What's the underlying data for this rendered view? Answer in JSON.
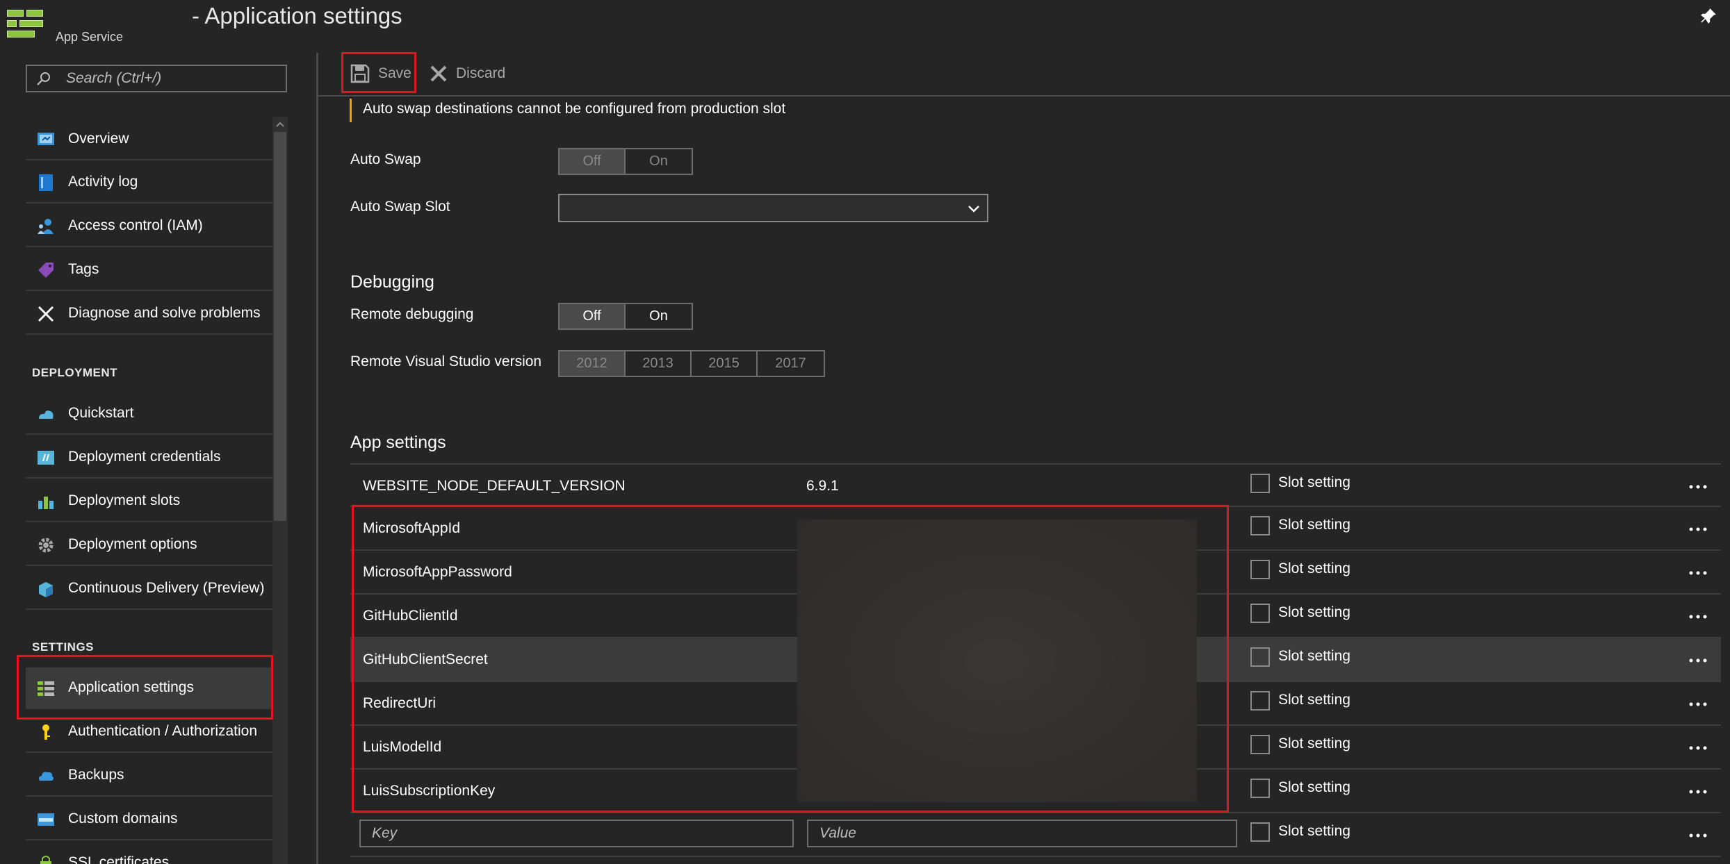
{
  "header": {
    "brand_sub": "App Service",
    "title": "- Application settings"
  },
  "sidebar": {
    "search_placeholder": "Search (Ctrl+/)",
    "items": [
      {
        "label": "Overview",
        "icon": "overview-icon"
      },
      {
        "label": "Activity log",
        "icon": "activity-log-icon"
      },
      {
        "label": "Access control (IAM)",
        "icon": "access-control-icon"
      },
      {
        "label": "Tags",
        "icon": "tag-icon"
      },
      {
        "label": "Diagnose and solve problems",
        "icon": "wrench-icon"
      }
    ],
    "deployment_header": "DEPLOYMENT",
    "deployment_items": [
      {
        "label": "Quickstart",
        "icon": "quickstart-icon"
      },
      {
        "label": "Deployment credentials",
        "icon": "credentials-icon"
      },
      {
        "label": "Deployment slots",
        "icon": "slots-icon"
      },
      {
        "label": "Deployment options",
        "icon": "gear-icon"
      },
      {
        "label": "Continuous Delivery (Preview)",
        "icon": "continuous-delivery-icon"
      }
    ],
    "settings_header": "SETTINGS",
    "settings_items": [
      {
        "label": "Application settings",
        "icon": "app-settings-icon"
      },
      {
        "label": "Authentication / Authorization",
        "icon": "key-icon"
      },
      {
        "label": "Backups",
        "icon": "cloud-icon"
      },
      {
        "label": "Custom domains",
        "icon": "www-icon"
      },
      {
        "label": "SSL certificates",
        "icon": "ssl-icon"
      }
    ]
  },
  "toolbar": {
    "save_label": "Save",
    "discard_label": "Discard"
  },
  "main": {
    "warning": "Auto swap destinations cannot be configured from production slot",
    "auto_swap": {
      "label": "Auto Swap",
      "options": [
        "Off",
        "On"
      ],
      "selected": "Off"
    },
    "auto_swap_slot": {
      "label": "Auto Swap Slot",
      "value": ""
    },
    "debugging": {
      "title": "Debugging",
      "remote_debugging": {
        "label": "Remote debugging",
        "options": [
          "Off",
          "On"
        ],
        "selected": "Off"
      },
      "vs_version": {
        "label": "Remote Visual Studio version",
        "options": [
          "2012",
          "2013",
          "2015",
          "2017"
        ],
        "selected": "2012"
      }
    },
    "app_settings": {
      "title": "App settings",
      "slot_label": "Slot setting",
      "rows": [
        {
          "key": "WEBSITE_NODE_DEFAULT_VERSION",
          "value": "6.9.1"
        },
        {
          "key": "MicrosoftAppId",
          "value": ""
        },
        {
          "key": "MicrosoftAppPassword",
          "value": ""
        },
        {
          "key": "GitHubClientId",
          "value": ""
        },
        {
          "key": "GitHubClientSecret",
          "value": ""
        },
        {
          "key": "RedirectUri",
          "value": ""
        },
        {
          "key": "LuisModelId",
          "value": ""
        },
        {
          "key": "LuisSubscriptionKey",
          "value": ""
        }
      ],
      "new_key_placeholder": "Key",
      "new_value_placeholder": "Value"
    }
  },
  "colors": {
    "background": "#252525",
    "highlight": "#e81123",
    "warning": "#f0a30a",
    "brand": "#8cc63f"
  }
}
